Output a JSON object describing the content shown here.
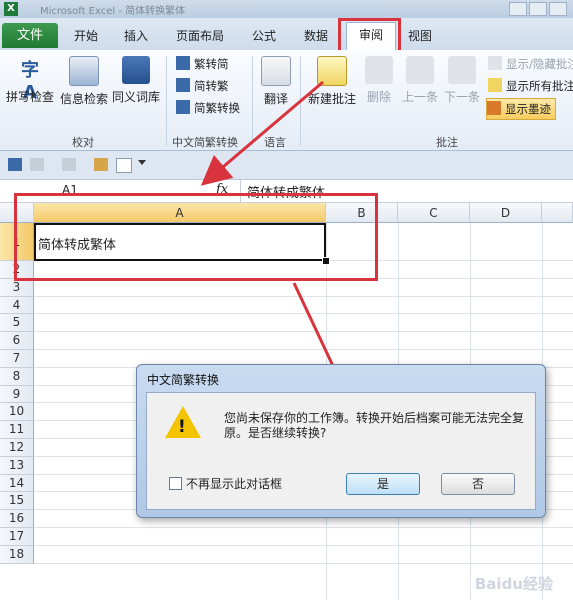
{
  "titlebar": {
    "logo": "X",
    "title": "Microsoft Excel - 简体转换繁体"
  },
  "tabs": [
    "文件",
    "开始",
    "插入",
    "页面布局",
    "公式",
    "数据",
    "审阅",
    "视图"
  ],
  "ribbon": {
    "proofing": {
      "spell": "拼写检查",
      "research": "信息检索",
      "thesaurus": "同义词库",
      "group": "校对"
    },
    "chinese": {
      "to_simplified": "繁转简",
      "to_traditional": "简转繁",
      "convert": "简繁转换",
      "group": "中文简繁转换"
    },
    "language": {
      "translate": "翻译",
      "group": "语言"
    },
    "comments": {
      "new": "新建批注",
      "delete": "删除",
      "prev": "上一条",
      "next": "下一条",
      "show_hide": "显示/隐藏批注",
      "show_all": "显示所有批注",
      "show_ink": "显示墨迹",
      "group": "批注"
    }
  },
  "formula": {
    "name_box": "A1",
    "fx": "fx",
    "content": "简体转成繁体"
  },
  "grid": {
    "columns": [
      "A",
      "B",
      "C",
      "D"
    ],
    "rows": [
      "1",
      "2",
      "3",
      "4",
      "5",
      "6",
      "7",
      "8",
      "9",
      "10",
      "11",
      "12",
      "13",
      "14",
      "15",
      "16",
      "17",
      "18"
    ],
    "a1": "简体转成繁体"
  },
  "dialog": {
    "title": "中文简繁转换",
    "message": "您尚未保存你的工作簿。转换开始后档案可能无法完全复原。是否继续转换?",
    "checkbox": "不再显示此对话框",
    "yes": "是",
    "no": "否"
  },
  "watermark": "Baidu经验",
  "colors": {
    "accent": "#d9333d",
    "excel_green": "#1f7a33",
    "selected_header": "#f3c86a"
  }
}
